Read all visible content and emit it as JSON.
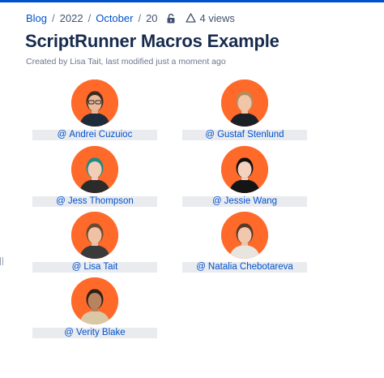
{
  "breadcrumb": {
    "items": [
      "Blog",
      "2022",
      "October",
      "20"
    ],
    "separator": "/",
    "views": "4 views"
  },
  "page": {
    "title": "ScriptRunner Macros Example",
    "byline": "Created by Lisa Tait, last modified just a moment ago"
  },
  "profiles": [
    {
      "mention": "@",
      "name": "Andrei Cuzuioc",
      "hair": "#3a2a1f",
      "skin": "#e9b99a",
      "shirt": "#1d2b3a",
      "glasses": true
    },
    {
      "mention": "@",
      "name": "Gustaf Stenlund",
      "hair": "#b88a5a",
      "skin": "#f0c5a8",
      "shirt": "#1b1f26",
      "glasses": false
    },
    {
      "mention": "@",
      "name": "Jess Thompson",
      "hair": "#1f8a86",
      "skin": "#f2cdb8",
      "shirt": "#2b2b2b",
      "glasses": false
    },
    {
      "mention": "@",
      "name": "Jessie Wang",
      "hair": "#121212",
      "skin": "#f3d3bf",
      "shirt": "#151515",
      "glasses": false
    },
    {
      "mention": "@",
      "name": "Lisa Tait",
      "hair": "#6a4a33",
      "skin": "#f0c2a3",
      "shirt": "#3a3a3a",
      "glasses": false
    },
    {
      "mention": "@",
      "name": "Natalia Chebotareva",
      "hair": "#5a3b28",
      "skin": "#f1c7ad",
      "shirt": "#e8e4df",
      "glasses": false
    },
    {
      "mention": "@",
      "name": "Verity Blake",
      "hair": "#2d1f16",
      "skin": "#b9835f",
      "shirt": "#d9c7a6",
      "glasses": false
    }
  ],
  "colors": {
    "link": "#0052cc",
    "avatar_bg": "#ff6a2b",
    "mention_bg": "#e9ebef",
    "topline": "#0052cc"
  },
  "icons": [
    "unlock-icon",
    "warning-icon"
  ]
}
